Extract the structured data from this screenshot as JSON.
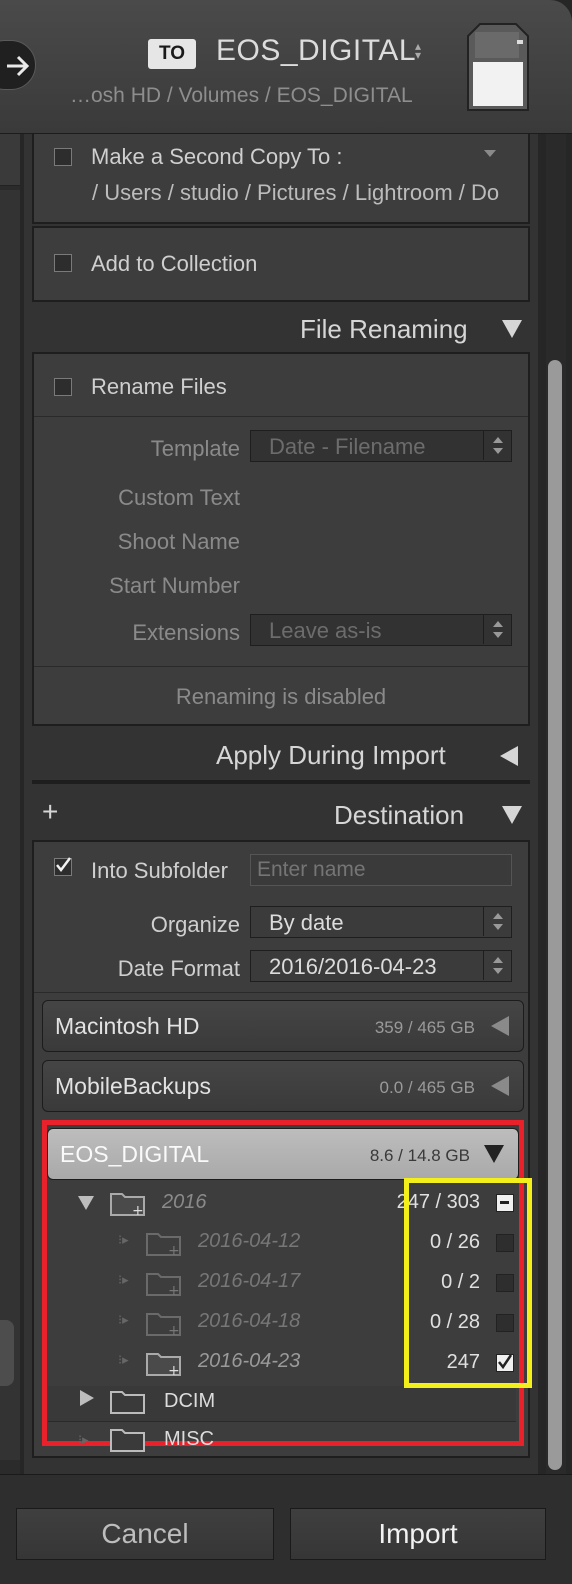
{
  "header": {
    "to_badge": "TO",
    "destination_title": "EOS_DIGITAL",
    "destination_path": "…osh HD / Volumes / EOS_DIGITAL"
  },
  "second_copy": {
    "label": "Make a Second Copy To :",
    "path": "/ Users / studio / Pictures / Lightroom / Do",
    "checked": false
  },
  "add_to_collection": {
    "label": "Add to Collection",
    "checked": false
  },
  "file_renaming": {
    "header": "File Renaming",
    "rename_files_label": "Rename Files",
    "template_label": "Template",
    "template_value": "Date - Filename",
    "custom_text_label": "Custom Text",
    "shoot_name_label": "Shoot Name",
    "start_number_label": "Start Number",
    "extensions_label": "Extensions",
    "extensions_value": "Leave as-is",
    "status": "Renaming is disabled"
  },
  "apply_during_import": {
    "header": "Apply During Import"
  },
  "destination": {
    "header": "Destination",
    "add_symbol": "+",
    "into_subfolder_label": "Into Subfolder",
    "into_subfolder_checked": true,
    "subfolder_placeholder": "Enter name",
    "organize_label": "Organize",
    "organize_value": "By date",
    "date_format_label": "Date Format",
    "date_format_value": "2016/2016-04-23"
  },
  "volumes": [
    {
      "name": "Macintosh HD",
      "size": "359 / 465 GB"
    },
    {
      "name": "MobileBackups",
      "size": "0.0 / 465 GB"
    },
    {
      "name": "EOS_DIGITAL",
      "size": "8.6 / 14.8 GB"
    }
  ],
  "folders": [
    {
      "name": "2016",
      "count": "247 / 303",
      "state": "mixed"
    },
    {
      "name": "2016-04-12",
      "count": "0 / 26",
      "state": "unchecked"
    },
    {
      "name": "2016-04-17",
      "count": "0 / 2",
      "state": "unchecked"
    },
    {
      "name": "2016-04-18",
      "count": "0 / 28",
      "state": "unchecked"
    },
    {
      "name": "2016-04-23",
      "count": "247",
      "state": "checked"
    },
    {
      "name": "DCIM"
    },
    {
      "name": "MISC"
    }
  ],
  "footer": {
    "cancel": "Cancel",
    "import": "Import"
  },
  "colors": {
    "highlight_red": "#e8212b",
    "highlight_yellow": "#f2ef1b",
    "panel_bg": "#333333"
  }
}
